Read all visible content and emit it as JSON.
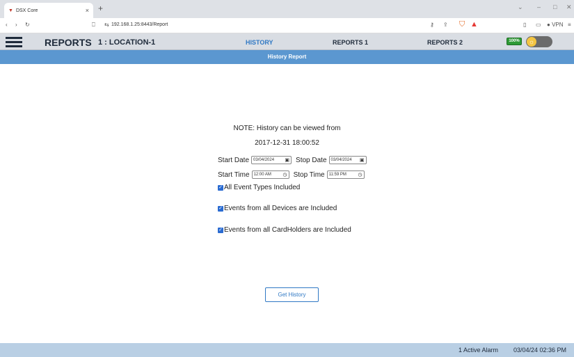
{
  "browser": {
    "tab_title": "DSX Core",
    "tab_close": "×",
    "new_tab": "+",
    "url": "192.168.1.25:8443/Report",
    "vpn_label": "VPN"
  },
  "header": {
    "title": "REPORTS",
    "location": "1 : LOCATION-1",
    "tabs": [
      {
        "label": "HISTORY"
      },
      {
        "label": "REPORTS 1"
      },
      {
        "label": "REPORTS 2"
      }
    ],
    "battery": "100%"
  },
  "subheader": {
    "title": "History Report"
  },
  "form": {
    "note_line1": "NOTE: History can be viewed from",
    "note_line2": "2017-12-31 18:00:52",
    "start_date_label": "Start Date",
    "start_date_value": "03/04/2024",
    "stop_date_label": "Stop Date",
    "stop_date_value": "03/04/2024",
    "start_time_label": "Start Time",
    "start_time_value": "12:00 AM",
    "stop_time_label": "Stop Time",
    "stop_time_value": "11:59 PM",
    "checkbox_event_types": "All Event Types Included",
    "checkbox_devices": "Events from all Devices are Included",
    "checkbox_cardholders": "Events from all CardHolders are Included",
    "submit_label": "Get History"
  },
  "footer": {
    "alarm": "1 Active Alarm",
    "datetime": "03/04/24 02:36 PM"
  },
  "colors": {
    "subheader_bg": "#5b97d0",
    "active_tab": "#2f78c4",
    "footer_bg": "#b9cfe4"
  }
}
